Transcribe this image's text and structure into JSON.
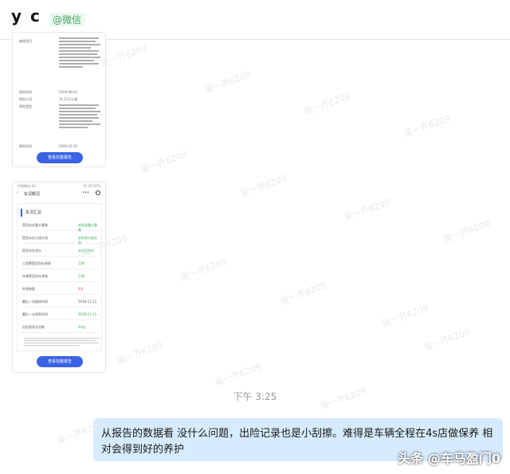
{
  "header": {
    "name": "y  c",
    "tag": "@微信"
  },
  "thumb1": {
    "rows": [
      "维修项目",
      "保险时间",
      "保险公司",
      "保险类型",
      "保险时间"
    ],
    "values": [
      "2020-06-01",
      "11.11万公里",
      "",
      "",
      "2020-12-31"
    ],
    "button": "查看完整报告"
  },
  "thumb2": {
    "status_left": "中国移动 4G",
    "status_right": "15:26  87%",
    "nav_title": "车况概况",
    "section": "车况汇总",
    "rows": [
      {
        "k": "是否存在重大事故",
        "v": "未发现重大事故"
      },
      {
        "k": "是否存在火烧水泡",
        "v": "未发现火烧水泡"
      },
      {
        "k": "是否存在泡水",
        "v": "未发现泡水"
      },
      {
        "k": "公里数是否存在调表",
        "v": "正常"
      },
      {
        "k": "车辆是否存在改装",
        "v": "正常"
      },
      {
        "k": "外观修复",
        "v": "4次"
      },
      {
        "k": "最后一次维修时间",
        "v": "2018-11-11"
      },
      {
        "k": "最后一次保养时间",
        "v": "2018-12-31"
      },
      {
        "k": "历史保养总次数",
        "v": "34次"
      }
    ],
    "button": "查看完整报告"
  },
  "time": "下午 3:25",
  "message": "从报告的数据看 没什么问题，出险记录也是小刮擦。难得是车辆全程在4s店做保养 相对会得到好的养护",
  "credit": "头条 @车马盈门0",
  "watermark": "吴一齐6209",
  "colors": {
    "bubble": "#d7ebff",
    "accent": "#3b63e6",
    "green": "#2eaa4c",
    "red": "#e04848"
  }
}
